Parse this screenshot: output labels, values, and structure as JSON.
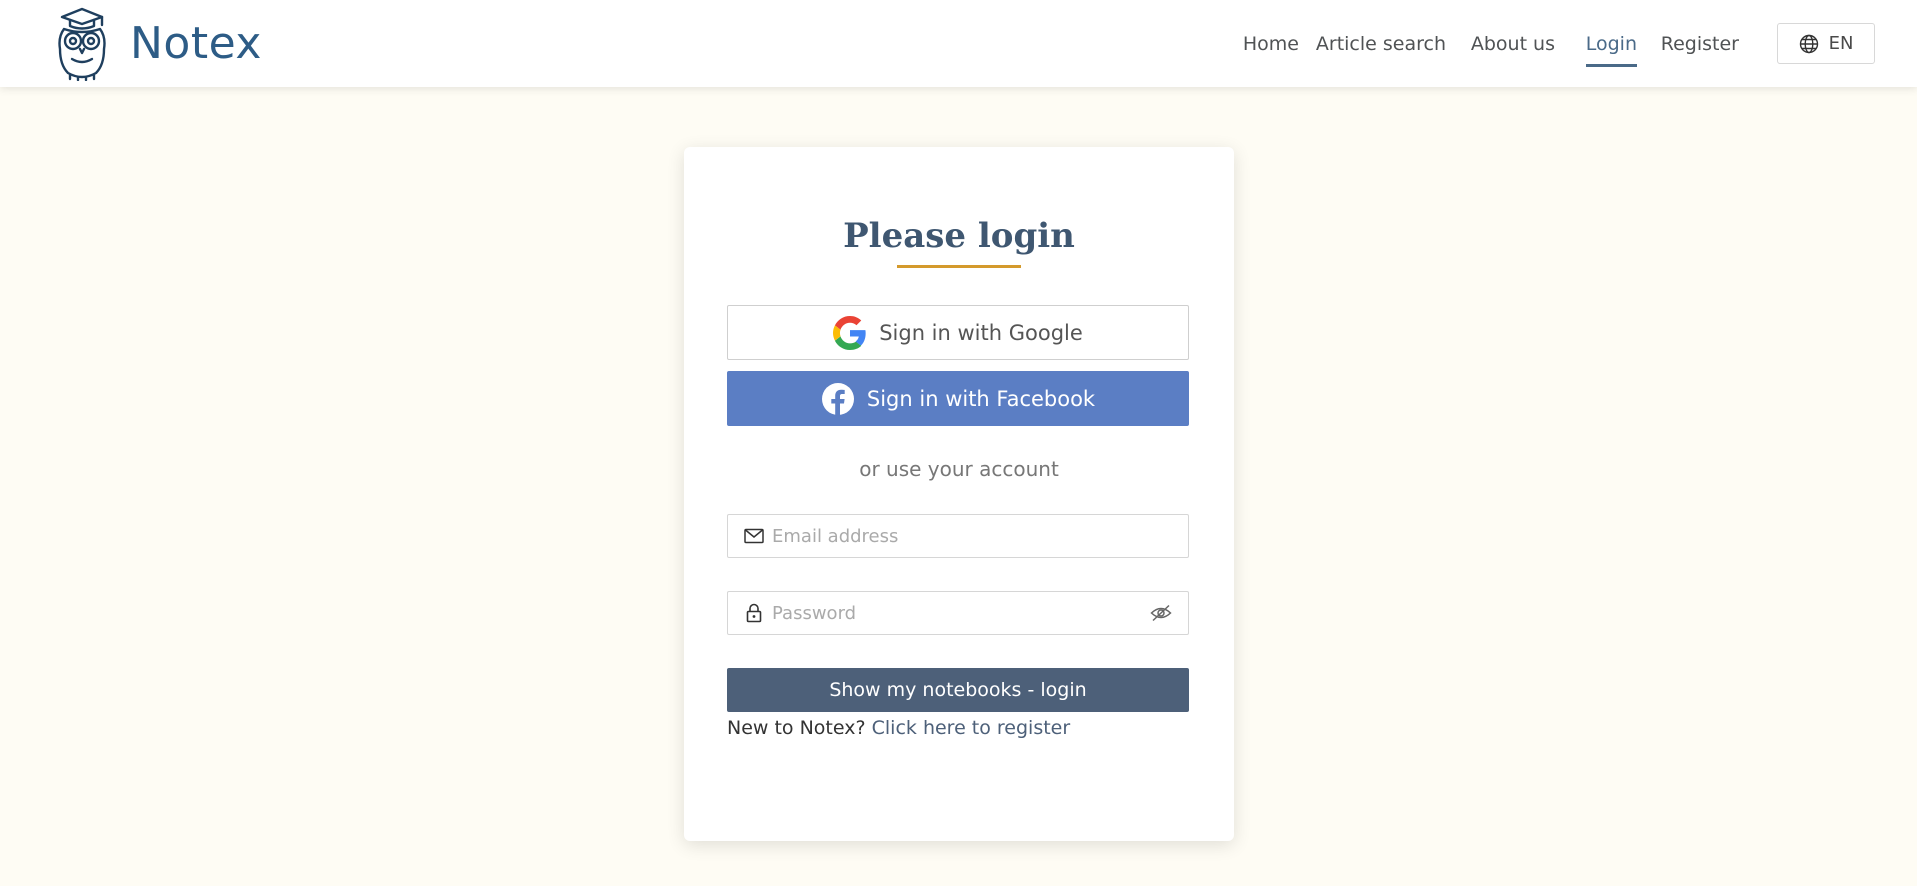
{
  "header": {
    "brand": "Notex",
    "nav": [
      {
        "label": "Home",
        "active": false
      },
      {
        "label": "Article search",
        "active": false
      },
      {
        "label": "About us",
        "active": false
      },
      {
        "label": "Login",
        "active": true
      },
      {
        "label": "Register",
        "active": false
      }
    ],
    "language": {
      "label": "EN",
      "icon": "globe-icon"
    }
  },
  "login": {
    "title": "Please login",
    "google_label": "Sign in with Google",
    "facebook_label": "Sign in with Facebook",
    "or_text": "or use your account",
    "email": {
      "placeholder": "Email address",
      "value": "",
      "icon": "envelope-icon"
    },
    "password": {
      "placeholder": "Password",
      "value": "",
      "icon": "lock-icon",
      "toggle_icon": "eye-slash-icon"
    },
    "submit_label": "Show my notebooks - login",
    "register_prompt": "New to Notex?",
    "register_link": "Click here to register"
  },
  "colors": {
    "page_background": "#fefcf4",
    "brand": "#2d5c86",
    "title": "#3f5771",
    "title_underline": "#d49a2c",
    "facebook": "#5b7ec4",
    "submit": "#4d6079",
    "active_nav": "#4a6a88"
  }
}
